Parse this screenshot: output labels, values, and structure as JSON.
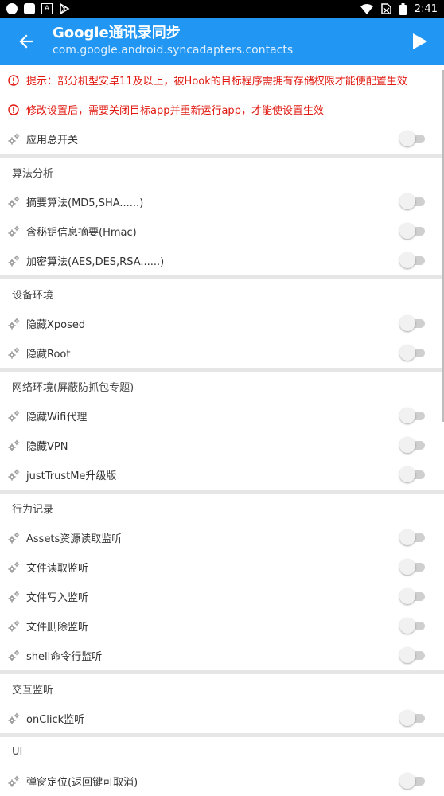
{
  "status_bar": {
    "time": "2:41",
    "left_icons": [
      "circle-icon",
      "square-icon",
      "a-box-icon",
      "play-store-icon"
    ],
    "right_icons": [
      "wifi-icon",
      "no-sim-icon",
      "battery-icon"
    ]
  },
  "app_bar": {
    "title": "Google通讯录同步",
    "subtitle": "com.google.android.syncadapters.contacts",
    "accent_color": "#2196f3"
  },
  "warnings": [
    "提示：部分机型安卓11及以上，被Hook的目标程序需拥有存储权限才能使配置生效",
    "修改设置后，需要关闭目标app并重新运行app，才能使设置生效"
  ],
  "master_switch": {
    "label": "应用总开关",
    "enabled": false
  },
  "sections": [
    {
      "title": "算法分析",
      "items": [
        {
          "label": "摘要算法(MD5,SHA......)",
          "enabled": false
        },
        {
          "label": "含秘钥信息摘要(Hmac)",
          "enabled": false
        },
        {
          "label": "加密算法(AES,DES,RSA......)",
          "enabled": false
        }
      ]
    },
    {
      "title": "设备环境",
      "items": [
        {
          "label": "隐藏Xposed",
          "enabled": false
        },
        {
          "label": "隐藏Root",
          "enabled": false
        }
      ]
    },
    {
      "title": "网络环境(屏蔽防抓包专题)",
      "items": [
        {
          "label": "隐藏Wifi代理",
          "enabled": false
        },
        {
          "label": "隐藏VPN",
          "enabled": false
        },
        {
          "label": "justTrustMe升级版",
          "enabled": false
        }
      ]
    },
    {
      "title": "行为记录",
      "items": [
        {
          "label": "Assets资源读取监听",
          "enabled": false
        },
        {
          "label": "文件读取监听",
          "enabled": false
        },
        {
          "label": "文件写入监听",
          "enabled": false
        },
        {
          "label": "文件删除监听",
          "enabled": false
        },
        {
          "label": "shell命令行监听",
          "enabled": false
        }
      ]
    },
    {
      "title": "交互监听",
      "items": [
        {
          "label": "onClick监听",
          "enabled": false
        }
      ]
    },
    {
      "title": "UI",
      "items": [
        {
          "label": "弹窗定位(返回键可取消)",
          "enabled": false
        }
      ]
    }
  ]
}
